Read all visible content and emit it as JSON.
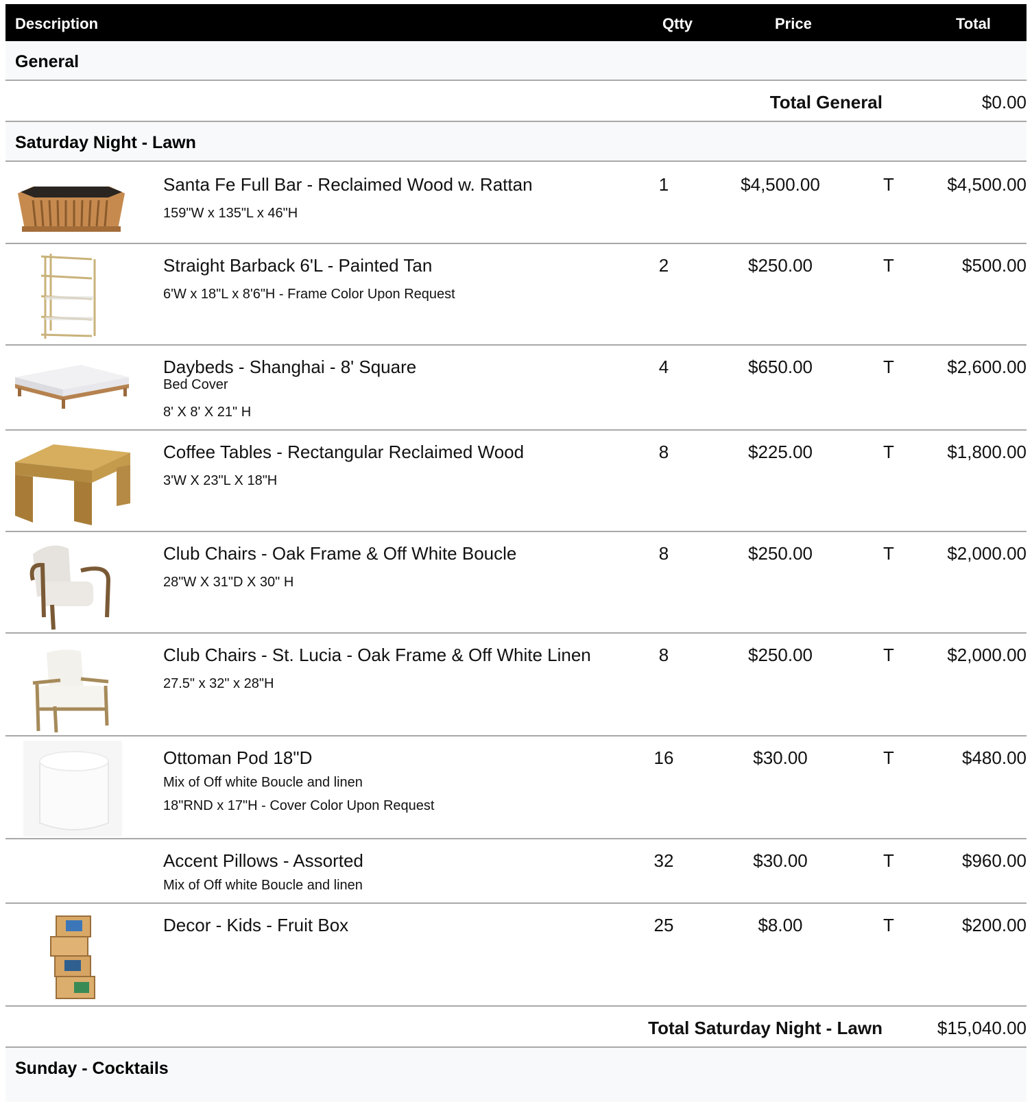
{
  "header": {
    "description": "Description",
    "qty": "Qtty",
    "price": "Price",
    "total": "Total"
  },
  "sections": {
    "general": {
      "title": "General",
      "total_label": "Total General",
      "total_amount": "$0.00"
    },
    "saturday": {
      "title": "Saturday Night - Lawn",
      "total_label": "Total Saturday Night - Lawn",
      "total_amount": "$15,040.00"
    },
    "sunday": {
      "title": "Sunday - Cocktails"
    }
  },
  "items": [
    {
      "name": "Santa Fe Full Bar - Reclaimed Wood w. Rattan",
      "line1": "159\"W x 135\"L x 46\"H",
      "line2": "",
      "qty": "1",
      "price": "$4,500.00",
      "tax": "T",
      "total": "$4,500.00",
      "icon": "bar-image"
    },
    {
      "name": "Straight Barback 6'L - Painted Tan",
      "line1": "6'W x 18\"L x 8'6\"H - Frame Color Upon Request",
      "line2": "",
      "qty": "2",
      "price": "$250.00",
      "tax": "T",
      "total": "$500.00",
      "icon": "shelf-image"
    },
    {
      "name": "Daybeds - Shanghai - 8' Square",
      "line1": "Bed Cover",
      "line2": "8' X 8' X 21\" H",
      "qty": "4",
      "price": "$650.00",
      "tax": "T",
      "total": "$2,600.00",
      "icon": "daybed-image"
    },
    {
      "name": "Coffee Tables - Rectangular Reclaimed Wood",
      "line1": "3'W X 23\"L X 18\"H",
      "line2": "",
      "qty": "8",
      "price": "$225.00",
      "tax": "T",
      "total": "$1,800.00",
      "icon": "coffee-table-image"
    },
    {
      "name": "Club Chairs - Oak Frame & Off White Boucle",
      "line1": "28\"W X 31\"D X 30\" H",
      "line2": "",
      "qty": "8",
      "price": "$250.00",
      "tax": "T",
      "total": "$2,000.00",
      "icon": "boucle-chair-image"
    },
    {
      "name": "Club Chairs - St. Lucia - Oak Frame & Off White Linen",
      "line1": "27.5\" x 32\" x 28\"H",
      "line2": "",
      "qty": "8",
      "price": "$250.00",
      "tax": "T",
      "total": "$2,000.00",
      "icon": "linen-chair-image"
    },
    {
      "name": "Ottoman Pod 18\"D",
      "line1": "Mix of Off white Boucle and linen",
      "line2": "18\"RND x 17\"H - Cover Color Upon Request",
      "qty": "16",
      "price": "$30.00",
      "tax": "T",
      "total": "$480.00",
      "icon": "ottoman-image"
    },
    {
      "name": "Accent Pillows - Assorted",
      "line1": "Mix of Off white Boucle and linen",
      "line2": "",
      "qty": "32",
      "price": "$30.00",
      "tax": "T",
      "total": "$960.00",
      "icon": ""
    },
    {
      "name": "Decor - Kids - Fruit Box",
      "line1": "",
      "line2": "",
      "qty": "25",
      "price": "$8.00",
      "tax": "T",
      "total": "$200.00",
      "icon": "fruit-box-image"
    }
  ]
}
